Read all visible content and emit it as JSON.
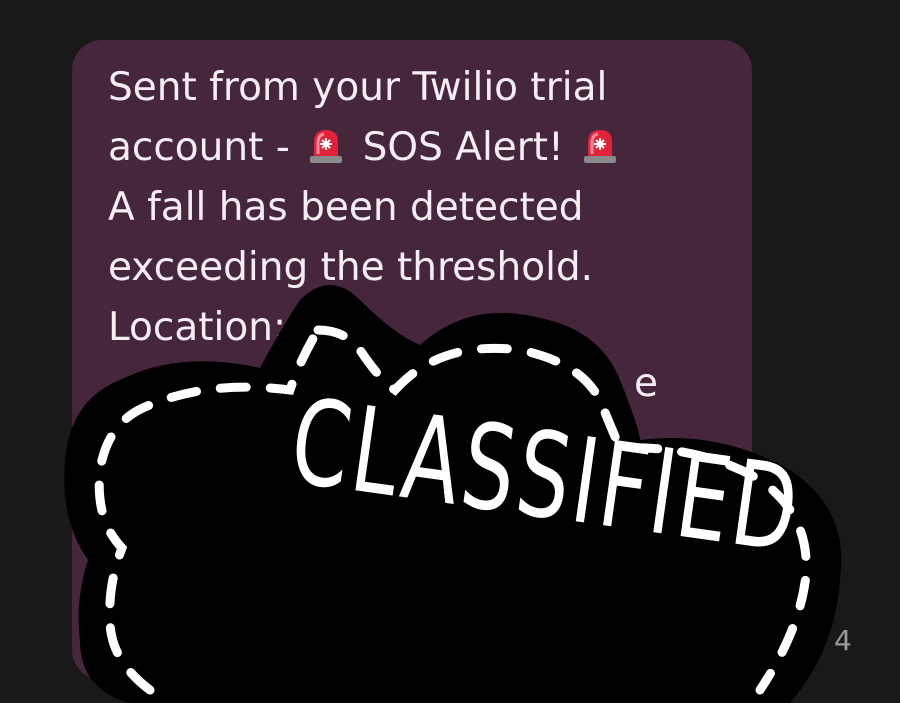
{
  "message": {
    "lines": [
      "Sent from your Twilio trial",
      "account -",
      "SOS Alert!",
      "A fall has been detected",
      "exceeding the threshold.",
      "Location:"
    ],
    "partial_text": "e",
    "timestamp_partial": "4",
    "emoji": "siren-icon"
  },
  "sticker": {
    "label": "CLASSIFIED"
  },
  "colors": {
    "background": "#191919",
    "bubble": "#45263a",
    "text": "#f4eef2",
    "sticker": "#000000",
    "sticker_text": "#ffffff"
  }
}
